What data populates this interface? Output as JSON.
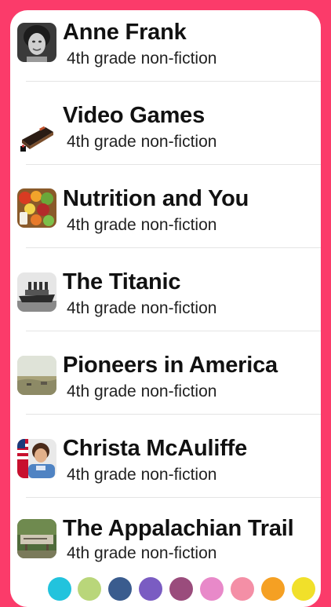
{
  "items": [
    {
      "title": "Anne Frank",
      "subtitle": "4th grade non-fiction",
      "icon": "portrait-photo-icon"
    },
    {
      "title": "Video Games",
      "subtitle": "4th grade non-fiction",
      "icon": "game-console-icon"
    },
    {
      "title": "Nutrition and You",
      "subtitle": "4th grade non-fiction",
      "icon": "fruit-basket-icon"
    },
    {
      "title": "The Titanic",
      "subtitle": "4th grade non-fiction",
      "icon": "ship-photo-icon"
    },
    {
      "title": "Pioneers in America",
      "subtitle": "4th grade non-fiction",
      "icon": "landscape-painting-icon"
    },
    {
      "title": "Christa McAuliffe",
      "subtitle": "4th grade non-fiction",
      "icon": "astronaut-portrait-icon"
    },
    {
      "title": "The Appalachian Trail",
      "subtitle": "4th grade non-fiction",
      "icon": "trail-sign-icon"
    }
  ],
  "theme": {
    "background": "#FB3B6A",
    "card": "#FFFFFF"
  },
  "color_dots": [
    "#22C3DD",
    "#B9D67A",
    "#3A5C8E",
    "#7A5CC2",
    "#9A4C7C",
    "#E889C9",
    "#F48FA6",
    "#F5A023",
    "#F1E02A"
  ]
}
